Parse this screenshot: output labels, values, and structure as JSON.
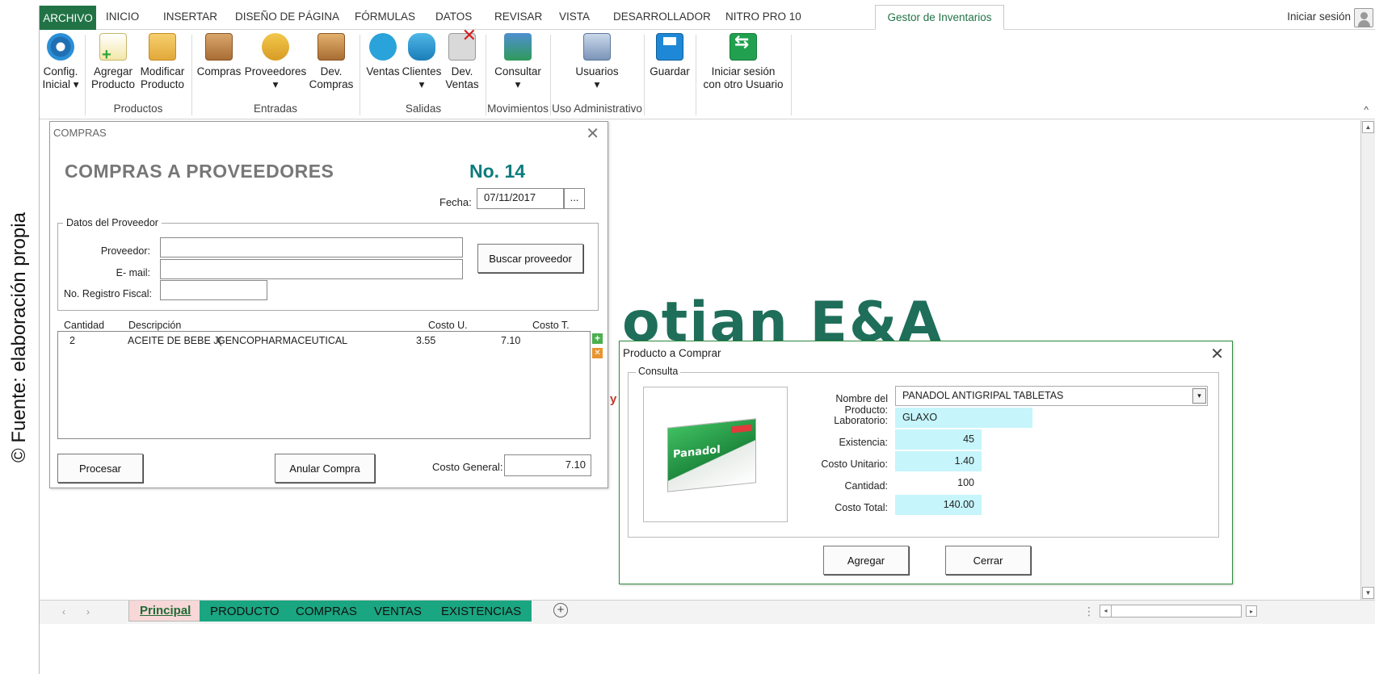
{
  "caption": "© Fuente: elaboración propia",
  "ribbon_tabs": [
    "ARCHIVO",
    "INICIO",
    "INSERTAR",
    "DISEÑO DE PÁGINA",
    "FÓRMULAS",
    "DATOS",
    "REVISAR",
    "VISTA",
    "DESARROLLADOR",
    "NITRO PRO 10",
    "Gestor de Inventarios"
  ],
  "signin": "Iniciar sesión",
  "ribbon": {
    "config": [
      "Config.",
      "Inicial ▾"
    ],
    "agregar": [
      "Agregar",
      "Producto"
    ],
    "modificar": [
      "Modificar",
      "Producto"
    ],
    "compras": [
      "Compras",
      ""
    ],
    "proveedores": [
      "Proveedores",
      "▾"
    ],
    "devcompras": [
      "Dev.",
      "Compras"
    ],
    "ventas": [
      "Ventas",
      ""
    ],
    "clientes": [
      "Clientes",
      "▾"
    ],
    "devventas": [
      "Dev.",
      "Ventas"
    ],
    "consultar": [
      "Consultar",
      "▾"
    ],
    "usuarios": [
      "Usuarios",
      "▾"
    ],
    "guardar": [
      "Guardar",
      ""
    ],
    "iniciarotro": [
      "Iniciar sesión",
      "con otro Usuario"
    ],
    "groups": {
      "productos": "Productos",
      "entradas": "Entradas",
      "salidas": "Salidas",
      "movimientos": "Movimientos",
      "uso_admin": "Uso Administrativo"
    },
    "collapse": "^"
  },
  "watermark": "otian E&A",
  "watermark_sub": "y",
  "sheet_tabs": [
    "Principal",
    "PRODUCTO",
    "COMPRAS",
    "VENTAS",
    "EXISTENCIAS"
  ],
  "sheet_nav": [
    "‹",
    "›"
  ],
  "add_sheet": "+",
  "scroll": {
    "dots": "⋮",
    "left": "◂",
    "right": "▸",
    "up": "▲",
    "down": "▼"
  },
  "compras_dialog": {
    "title": "COMPRAS",
    "close": "✕",
    "heading": "COMPRAS A PROVEEDORES",
    "number": "No. 14",
    "fecha_label": "Fecha:",
    "fecha_value": "07/11/2017",
    "fecha_button": "...",
    "proveedor_legend": "Datos del Proveedor",
    "proveedor_label": "Proveedor:",
    "email_label": "E- mail:",
    "registro_label": "No. Registro Fiscal:",
    "proveedor_value": "",
    "email_value": "",
    "registro_value": "",
    "buscar_button": "Buscar proveedor",
    "columns": [
      "Cantidad",
      "Descripción",
      "Costo U.",
      "Costo T."
    ],
    "items": [
      {
        "cantidad": "2",
        "descripcion": "ACEITE DE BEBE J(",
        "proveedor": "GENCOPHARMACEUTICAL",
        "costo_u": "3.55",
        "costo_t": "7.10"
      }
    ],
    "procesar_button": "Procesar",
    "anular_button": "Anular Compra",
    "costo_general_label": "Costo General:",
    "costo_general_value": "7.10"
  },
  "producto_dialog": {
    "title": "Producto a Comprar",
    "close": "✕",
    "consulta_legend": "Consulta",
    "image_brand": "Panadol",
    "nombre_label": "Nombre del Producto:",
    "nombre_value": "PANADOL ANTIGRIPAL  TABLETAS",
    "dropdown": "▾",
    "laboratorio_label": "Laboratorio:",
    "laboratorio_value": "GLAXO",
    "existencia_label": "Existencia:",
    "existencia_value": "45",
    "costo_unitario_label": "Costo Unitario:",
    "costo_unitario_value": "1.40",
    "cantidad_label": "Cantidad:",
    "cantidad_value": "100",
    "costo_total_label": "Costo Total:",
    "costo_total_value": "140.00",
    "agregar_button": "Agregar",
    "cerrar_button": "Cerrar"
  }
}
